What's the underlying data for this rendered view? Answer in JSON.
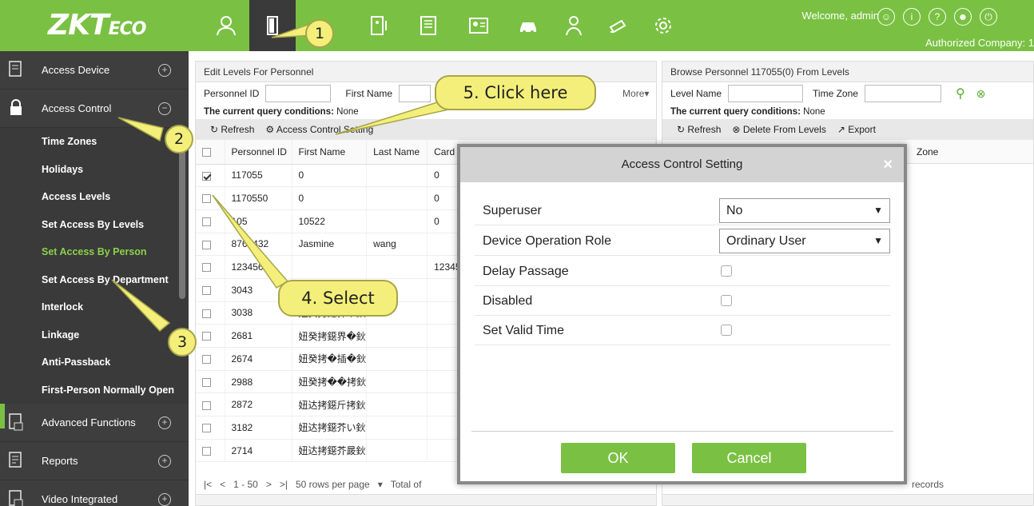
{
  "brand": {
    "logo_main": "ZKT",
    "logo_eco": "ECO"
  },
  "header": {
    "welcome": "Welcome, admin",
    "company": "Authorized Company: 1"
  },
  "nav_icons": [
    "personnel-icon",
    "access-door-icon",
    "attendance-icon",
    "elevator-icon",
    "visitor-icon",
    "parking-icon",
    "patrol-icon",
    "video-icon",
    "settings-icon"
  ],
  "sidebar": {
    "sections": [
      {
        "label": "Access Device",
        "icon": "device-icon",
        "expander": "+"
      },
      {
        "label": "Access Control",
        "icon": "lock-icon",
        "expander": "−"
      }
    ],
    "items": [
      {
        "label": "Time Zones"
      },
      {
        "label": "Holidays"
      },
      {
        "label": "Access Levels"
      },
      {
        "label": "Set Access By Levels"
      },
      {
        "label": "Set Access By Person"
      },
      {
        "label": "Set Access By Department"
      },
      {
        "label": "Interlock"
      },
      {
        "label": "Linkage"
      },
      {
        "label": "Anti-Passback"
      },
      {
        "label": "First-Person Normally Open"
      }
    ],
    "bottom_sections": [
      {
        "label": "Advanced Functions",
        "icon": "advanced-icon",
        "expander": "+"
      },
      {
        "label": "Reports",
        "icon": "report-icon",
        "expander": "+"
      },
      {
        "label": "Video Integrated",
        "icon": "video-integrated-icon",
        "expander": "+"
      }
    ]
  },
  "left_panel": {
    "title": "Edit Levels For Personnel",
    "query_labels": {
      "personnel_id": "Personnel ID",
      "first_name": "First Name",
      "more": "More▾"
    },
    "conditions_label": "The current query conditions:",
    "conditions_value": "None",
    "toolbar": {
      "refresh": "Refresh",
      "access_control_setting": "Access Control Setting"
    },
    "columns": [
      "Personnel ID",
      "First Name",
      "Last Name",
      "Card Nu"
    ],
    "rows": [
      {
        "checked": true,
        "id": "117055",
        "first": "0",
        "last": "",
        "card": "0"
      },
      {
        "checked": false,
        "id": "1170550",
        "first": "0",
        "last": "",
        "card": "0"
      },
      {
        "checked": false,
        "id": "105",
        "first": "10522",
        "last": "",
        "card": "0"
      },
      {
        "checked": false,
        "id": "8765432",
        "first": "Jasmine",
        "last": "wang",
        "card": ""
      },
      {
        "checked": false,
        "id": "1234567",
        "first": "",
        "last": "",
        "card": "1234567"
      },
      {
        "checked": false,
        "id": "3043",
        "first": "",
        "last": "",
        "card": ""
      },
      {
        "checked": false,
        "id": "3038",
        "first": "妞癸拷鐚界�鈥",
        "last": "",
        "card": ""
      },
      {
        "checked": false,
        "id": "2681",
        "first": "妞癸拷鐚界�鈥",
        "last": "",
        "card": ""
      },
      {
        "checked": false,
        "id": "2674",
        "first": "妞癸拷�插�鈥",
        "last": "",
        "card": ""
      },
      {
        "checked": false,
        "id": "2988",
        "first": "妞癸拷��拷鈥",
        "last": "",
        "card": ""
      },
      {
        "checked": false,
        "id": "2872",
        "first": "妞达拷鐚斤拷鈥",
        "last": "",
        "card": ""
      },
      {
        "checked": false,
        "id": "3182",
        "first": "妞达拷鐚芥い鈥",
        "last": "",
        "card": ""
      },
      {
        "checked": false,
        "id": "2714",
        "first": "妞达拷鐚芥晸鈥",
        "last": "",
        "card": ""
      }
    ],
    "pager": {
      "range": "1 - 50",
      "rows_per_page": "50 rows per page",
      "total": "Total of"
    }
  },
  "right_panel": {
    "title": "Browse Personnel 117055(0) From Levels",
    "query_labels": {
      "level_name": "Level Name",
      "time_zone": "Time Zone"
    },
    "conditions_label": "The current query conditions:",
    "conditions_value": "None",
    "toolbar": {
      "refresh": "Refresh",
      "delete": "Delete From Levels",
      "export": "Export"
    },
    "column_zone": "Zone",
    "records": "records"
  },
  "modal": {
    "title": "Access Control Setting",
    "close": "×",
    "superuser_label": "Superuser",
    "superuser_value": "No",
    "role_label": "Device Operation Role",
    "role_value": "Ordinary User",
    "delay_label": "Delay Passage",
    "disabled_label": "Disabled",
    "valid_time_label": "Set Valid Time",
    "ok": "OK",
    "cancel": "Cancel"
  },
  "callouts": {
    "step1": "1",
    "step2": "2",
    "step3": "3",
    "step4": "4. Select",
    "step5": "5. Click here",
    "color": "#f3ef7a"
  },
  "colors": {
    "brand_green": "#7ac143",
    "sidebar_dark": "#3e3e3e",
    "active_item": "#8bd14a",
    "modal_header": "#d3d3d3"
  }
}
